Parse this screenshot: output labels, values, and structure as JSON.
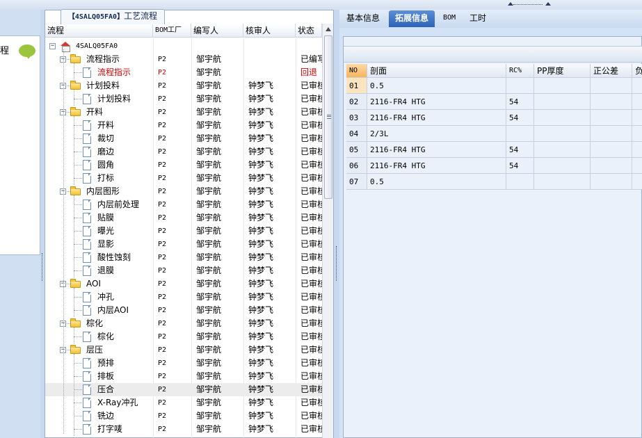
{
  "window": {
    "panel_tab_label": "工艺流程",
    "panel_tab_code": "【4SALQ05FA0】"
  },
  "nav": {
    "label": "程",
    "bubble_icon": "speech-bubble-icon"
  },
  "process_grid": {
    "columns": [
      "流程",
      "BOM工厂",
      "编写人",
      "核审人",
      "状态"
    ],
    "root_label": "4SALQ05FA0",
    "rows": [
      {
        "label": "流程指示",
        "type": "folder",
        "level": 1,
        "bom": "P2",
        "writer": "邹宇航",
        "reviewer": "",
        "status": "已编写",
        "red": false,
        "selected": false
      },
      {
        "label": "流程指示",
        "type": "doc",
        "level": 2,
        "bom": "P2",
        "writer": "邹宇航",
        "reviewer": "",
        "status": "回退",
        "red": true,
        "selected": false
      },
      {
        "label": "计划投料",
        "type": "folder",
        "level": 1,
        "bom": "P2",
        "writer": "邹宇航",
        "reviewer": "钟梦飞",
        "status": "已审核",
        "red": false,
        "selected": false
      },
      {
        "label": "计划投料",
        "type": "doc",
        "level": 2,
        "bom": "P2",
        "writer": "邹宇航",
        "reviewer": "钟梦飞",
        "status": "已审核",
        "red": false,
        "selected": false
      },
      {
        "label": "开料",
        "type": "folder",
        "level": 1,
        "bom": "P2",
        "writer": "邹宇航",
        "reviewer": "钟梦飞",
        "status": "已审核",
        "red": false,
        "selected": false
      },
      {
        "label": "开料",
        "type": "doc",
        "level": 2,
        "bom": "P2",
        "writer": "邹宇航",
        "reviewer": "钟梦飞",
        "status": "已审核",
        "red": false,
        "selected": false
      },
      {
        "label": "裁切",
        "type": "doc",
        "level": 2,
        "bom": "P2",
        "writer": "邹宇航",
        "reviewer": "钟梦飞",
        "status": "已审核",
        "red": false,
        "selected": false
      },
      {
        "label": "磨边",
        "type": "doc",
        "level": 2,
        "bom": "P2",
        "writer": "邹宇航",
        "reviewer": "钟梦飞",
        "status": "已审核",
        "red": false,
        "selected": false
      },
      {
        "label": "圆角",
        "type": "doc",
        "level": 2,
        "bom": "P2",
        "writer": "邹宇航",
        "reviewer": "钟梦飞",
        "status": "已审核",
        "red": false,
        "selected": false
      },
      {
        "label": "打标",
        "type": "doc",
        "level": 2,
        "bom": "P2",
        "writer": "邹宇航",
        "reviewer": "钟梦飞",
        "status": "已审核",
        "red": false,
        "selected": false
      },
      {
        "label": "内层图形",
        "type": "folder",
        "level": 1,
        "bom": "P2",
        "writer": "邹宇航",
        "reviewer": "钟梦飞",
        "status": "已审核",
        "red": false,
        "selected": false
      },
      {
        "label": "内层前处理",
        "type": "doc",
        "level": 2,
        "bom": "P2",
        "writer": "邹宇航",
        "reviewer": "钟梦飞",
        "status": "已审核",
        "red": false,
        "selected": false
      },
      {
        "label": "贴膜",
        "type": "doc",
        "level": 2,
        "bom": "P2",
        "writer": "邹宇航",
        "reviewer": "钟梦飞",
        "status": "已审核",
        "red": false,
        "selected": false
      },
      {
        "label": "曝光",
        "type": "doc",
        "level": 2,
        "bom": "P2",
        "writer": "邹宇航",
        "reviewer": "钟梦飞",
        "status": "已审核",
        "red": false,
        "selected": false
      },
      {
        "label": "显影",
        "type": "doc",
        "level": 2,
        "bom": "P2",
        "writer": "邹宇航",
        "reviewer": "钟梦飞",
        "status": "已审核",
        "red": false,
        "selected": false
      },
      {
        "label": "酸性蚀刻",
        "type": "doc",
        "level": 2,
        "bom": "P2",
        "writer": "邹宇航",
        "reviewer": "钟梦飞",
        "status": "已审核",
        "red": false,
        "selected": false
      },
      {
        "label": "退膜",
        "type": "doc",
        "level": 2,
        "bom": "P2",
        "writer": "邹宇航",
        "reviewer": "钟梦飞",
        "status": "已审核",
        "red": false,
        "selected": false
      },
      {
        "label": "AOI",
        "type": "folder",
        "level": 1,
        "bom": "P2",
        "writer": "邹宇航",
        "reviewer": "钟梦飞",
        "status": "已审核",
        "red": false,
        "selected": false
      },
      {
        "label": "冲孔",
        "type": "doc",
        "level": 2,
        "bom": "P2",
        "writer": "邹宇航",
        "reviewer": "钟梦飞",
        "status": "已审核",
        "red": false,
        "selected": false
      },
      {
        "label": "内层AOI",
        "type": "doc",
        "level": 2,
        "bom": "P2",
        "writer": "邹宇航",
        "reviewer": "钟梦飞",
        "status": "已审核",
        "red": false,
        "selected": false
      },
      {
        "label": "棕化",
        "type": "folder",
        "level": 1,
        "bom": "P2",
        "writer": "邹宇航",
        "reviewer": "钟梦飞",
        "status": "已审核",
        "red": false,
        "selected": false
      },
      {
        "label": "棕化",
        "type": "doc",
        "level": 2,
        "bom": "P2",
        "writer": "邹宇航",
        "reviewer": "钟梦飞",
        "status": "已审核",
        "red": false,
        "selected": false
      },
      {
        "label": "层压",
        "type": "folder",
        "level": 1,
        "bom": "P2",
        "writer": "邹宇航",
        "reviewer": "钟梦飞",
        "status": "已审核",
        "red": false,
        "selected": false
      },
      {
        "label": "预排",
        "type": "doc",
        "level": 2,
        "bom": "P2",
        "writer": "邹宇航",
        "reviewer": "钟梦飞",
        "status": "已审核",
        "red": false,
        "selected": false
      },
      {
        "label": "排板",
        "type": "doc",
        "level": 2,
        "bom": "P2",
        "writer": "邹宇航",
        "reviewer": "钟梦飞",
        "status": "已审核",
        "red": false,
        "selected": false
      },
      {
        "label": "压合",
        "type": "doc",
        "level": 2,
        "bom": "P2",
        "writer": "邹宇航",
        "reviewer": "钟梦飞",
        "status": "已审核",
        "red": false,
        "selected": true
      },
      {
        "label": "X-Ray冲孔",
        "type": "doc",
        "level": 2,
        "bom": "P2",
        "writer": "邹宇航",
        "reviewer": "钟梦飞",
        "status": "已审核",
        "red": false,
        "selected": false
      },
      {
        "label": "铣边",
        "type": "doc",
        "level": 2,
        "bom": "P2",
        "writer": "邹宇航",
        "reviewer": "钟梦飞",
        "status": "已审核",
        "red": false,
        "selected": false
      },
      {
        "label": "打字唛",
        "type": "doc",
        "level": 2,
        "bom": "P2",
        "writer": "邹宇航",
        "reviewer": "钟梦飞",
        "status": "已审核",
        "red": false,
        "selected": false
      }
    ]
  },
  "right_tabs": [
    {
      "label": "基本信息",
      "active": false
    },
    {
      "label": "拓展信息",
      "active": true
    },
    {
      "label": "BOM",
      "active": false
    },
    {
      "label": "工时",
      "active": false
    }
  ],
  "ext_grid": {
    "columns": [
      "NO",
      "剖面",
      "RC%",
      "PP厚度",
      "正公差",
      "负"
    ],
    "rows": [
      {
        "no": "01",
        "section": "0.5",
        "rc": "",
        "pp": "",
        "pos": "",
        "neg": ""
      },
      {
        "no": "02",
        "section": "2116-FR4 HTG",
        "rc": "54",
        "pp": "",
        "pos": "",
        "neg": ""
      },
      {
        "no": "03",
        "section": "2116-FR4 HTG",
        "rc": "54",
        "pp": "",
        "pos": "",
        "neg": ""
      },
      {
        "no": "04",
        "section": "2/3L",
        "rc": "",
        "pp": "",
        "pos": "",
        "neg": ""
      },
      {
        "no": "05",
        "section": "2116-FR4 HTG",
        "rc": "54",
        "pp": "",
        "pos": "",
        "neg": ""
      },
      {
        "no": "06",
        "section": "2116-FR4 HTG",
        "rc": "54",
        "pp": "",
        "pos": "",
        "neg": ""
      },
      {
        "no": "07",
        "section": "0.5",
        "rc": "",
        "pp": "",
        "pos": "",
        "neg": ""
      }
    ]
  }
}
